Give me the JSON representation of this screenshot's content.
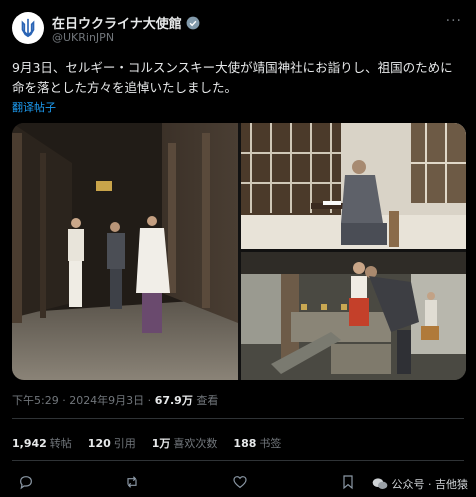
{
  "account": {
    "display_name": "在日ウクライナ大使館",
    "handle": "@UKRinJPN"
  },
  "tweet": {
    "text": "9月3日、セルギー・コルスンスキー大使が靖国神社にお詣りし、祖国のために命を落とした方々を追悼いたしました。",
    "translate_label": "翻译帖子"
  },
  "meta": {
    "time": "下午5:29 · 2024年9月3日 · ",
    "views": "67.9万",
    "views_label": " 查看"
  },
  "stats": [
    {
      "value": "1,942",
      "label": "转帖"
    },
    {
      "value": "120",
      "label": "引用"
    },
    {
      "value": "1万",
      "label": "喜欢次数"
    },
    {
      "value": "188",
      "label": "书签"
    }
  ],
  "watermark": "公众号 · 吉他猿",
  "icons": [
    "more-icon",
    "verified-badge-icon",
    "reply-icon",
    "retweet-icon",
    "like-icon",
    "bookmark-icon",
    "share-icon"
  ],
  "colors": {
    "background": "#000000",
    "text": "#e7e9ea",
    "muted": "#71767b",
    "link": "#1d9bf0"
  }
}
